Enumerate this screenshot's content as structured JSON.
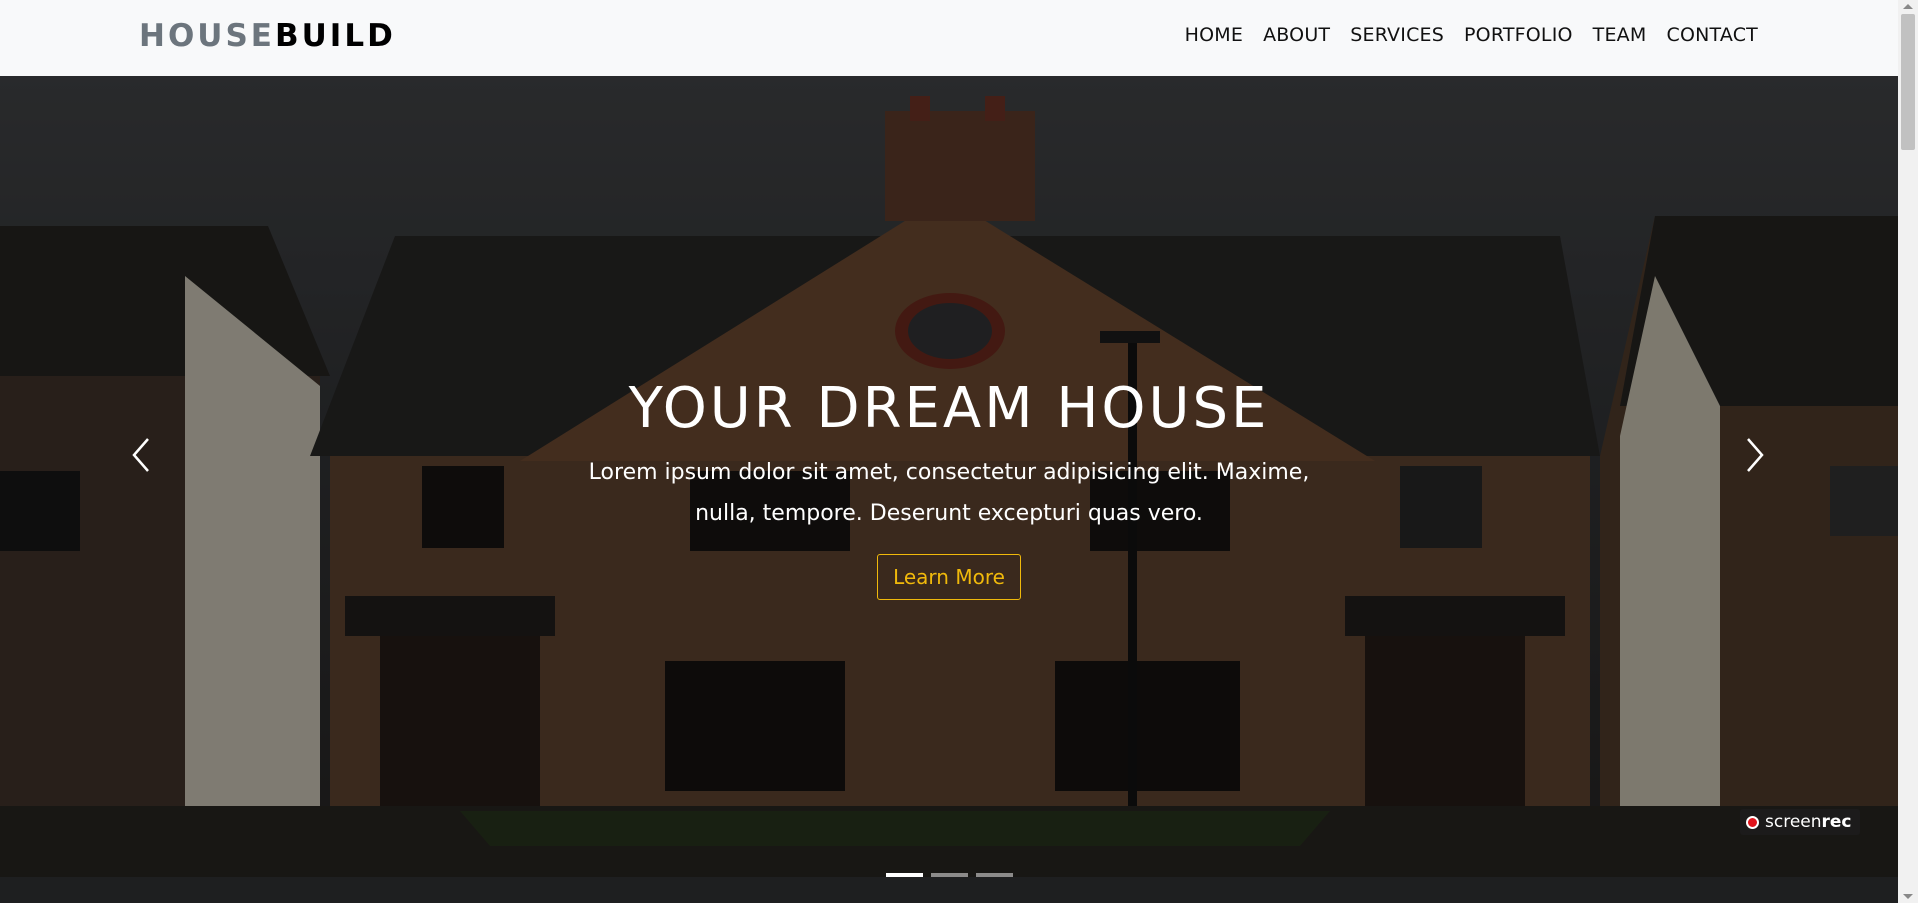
{
  "brand": {
    "part1": "HOUSE",
    "part2": "BUILD"
  },
  "nav": {
    "items": [
      "HOME",
      "ABOUT",
      "SERVICES",
      "PORTFOLIO",
      "TEAM",
      "CONTACT"
    ]
  },
  "hero": {
    "title": "YOUR DREAM HOUSE",
    "text": "Lorem ipsum dolor sit amet, consectetur adipisicing elit. Maxime, nulla, tempore. Deserunt excepturi quas vero.",
    "button_label": "Learn More",
    "active_slide": 1,
    "slide_count": 3
  },
  "controls": {
    "prev_icon": "chevron-left-icon",
    "next_icon": "chevron-right-icon"
  },
  "watermark": {
    "part1": "screen",
    "part2": "rec"
  },
  "colors": {
    "navbar_bg": "#f8f9fa",
    "accent": "#f0b90b",
    "brand_muted": "#6c757d",
    "record_red": "#e0141c"
  }
}
